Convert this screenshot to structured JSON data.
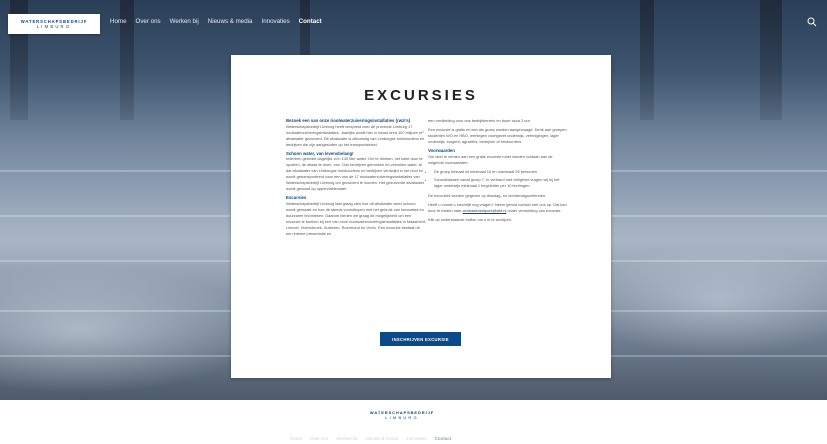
{
  "header": {
    "logo_top": "WATERSCHAPSBEDRIJF",
    "logo_bottom": "LIMBURG",
    "nav": [
      {
        "label": "Home"
      },
      {
        "label": "Over ons"
      },
      {
        "label": "Werken bij"
      },
      {
        "label": "Nieuws & media"
      },
      {
        "label": "Innovaties"
      },
      {
        "label": "Contact"
      }
    ],
    "search_icon": "search-icon"
  },
  "card": {
    "title": "EXCURSIES",
    "left": {
      "h1": "Bezoek een van onze rioolwaterzuiveringsinstallaties (rwzi's)",
      "p1": "Waterschapsbedrijf Limburg heeft verspreid over de provincie Limburg 17 rioolwaterzuiveringsinstallaties. Jaarlijks wordt hier in totaal circa 100 miljoen m³ afvalwater gezuiverd. Dit afvalwater is afkomstig van Limburgse huishoudens en bedrijven die zijn aangesloten op het transportstelsel.",
      "h2": "Schoon water, van levensbelang!",
      "p2": "Iedereen gebruikt dagelijks zo'n 130 liter water. Om te drinken, het toilet door te spoelen, de afwas te doen, enz. Ook bedrijven gebruiken en vervuilen water. Al dat afvalwater van Limburgse huishoudens en bedrijven verdwijnt in het riool en wordt getransporteerd naar een van de 17 rioolwaterzuiveringsinstallaties van Waterschapsbedrijf Limburg om gezuiverd te worden. Het gezuiverde afvalwater wordt geloosd op oppervlaktewater.",
      "h3": "Excursies",
      "p3": "Waterschapsbedrijf Limburg laat graag zien hoe dit afvalwater weer schoon wordt gemaakt en hoe de steeds vooruitlopen met het gebruik van innovaties en duurzame technieken. Daarom bieden we graag de mogelijkheid om een excursie te boeken bij een van onze rioolwaterzuiveringsinstallaties in Maastricht, Limmel, Hoensbroek, Susteren, Roermond en Venlo. Een excursie bestaat uit een interne presentatie en"
    },
    "right": {
      "p1": "een rondleiding voor ons bedrijfsterrein en duurt circa 2 uur.",
      "p2": "Een excursie is gratis en kan als groep worden aangevraagd. Denk aan groepen studenten WO en HBO, leerlingen voortgezet onderwijs, verenigingen, lager onderwijs, burgers, agrariërs, bedrijven of bestuurders.",
      "h1": "Voorwaarden",
      "p3": "Om deel te nemen aan een gratis excursie moet worden voldaan aan de volgende voorwaarden:",
      "b1": "De groep bestaat uit minimaal 10 en maximaal 25 personen",
      "b2": "Schoolklassen vanaf groep 7. In verband met veiligheid vragen wij bij het lager onderwijs minimaal 1 begeleider per 10 leerlingen.",
      "p4": "De excursies worden gegeven op dinsdag- en donderdagochtenden.",
      "p5a": "Heeft u vooraf u inschrijft nog vragen? Neem gerust contact met ons op. Dat kan door te mailen naar ",
      "p5link": "centraalmeldpunt@wbl.nl",
      "p5b": " onder vermelding van excursie.",
      "p6": "Klik op onderstaande button om u in te schrijven."
    },
    "cta": "INSCHRIJVEN EXCURSIE"
  },
  "footer": {
    "logo_top": "WATERSCHAPSBEDRIJF",
    "logo_bottom": "LIMBURG",
    "nav": [
      {
        "label": "Home"
      },
      {
        "label": "Over ons"
      },
      {
        "label": "Werken bij"
      },
      {
        "label": "Nieuws & media"
      },
      {
        "label": "Innovaties"
      },
      {
        "label": "Contact"
      }
    ]
  },
  "colors": {
    "brand": "#0b4a8a"
  }
}
